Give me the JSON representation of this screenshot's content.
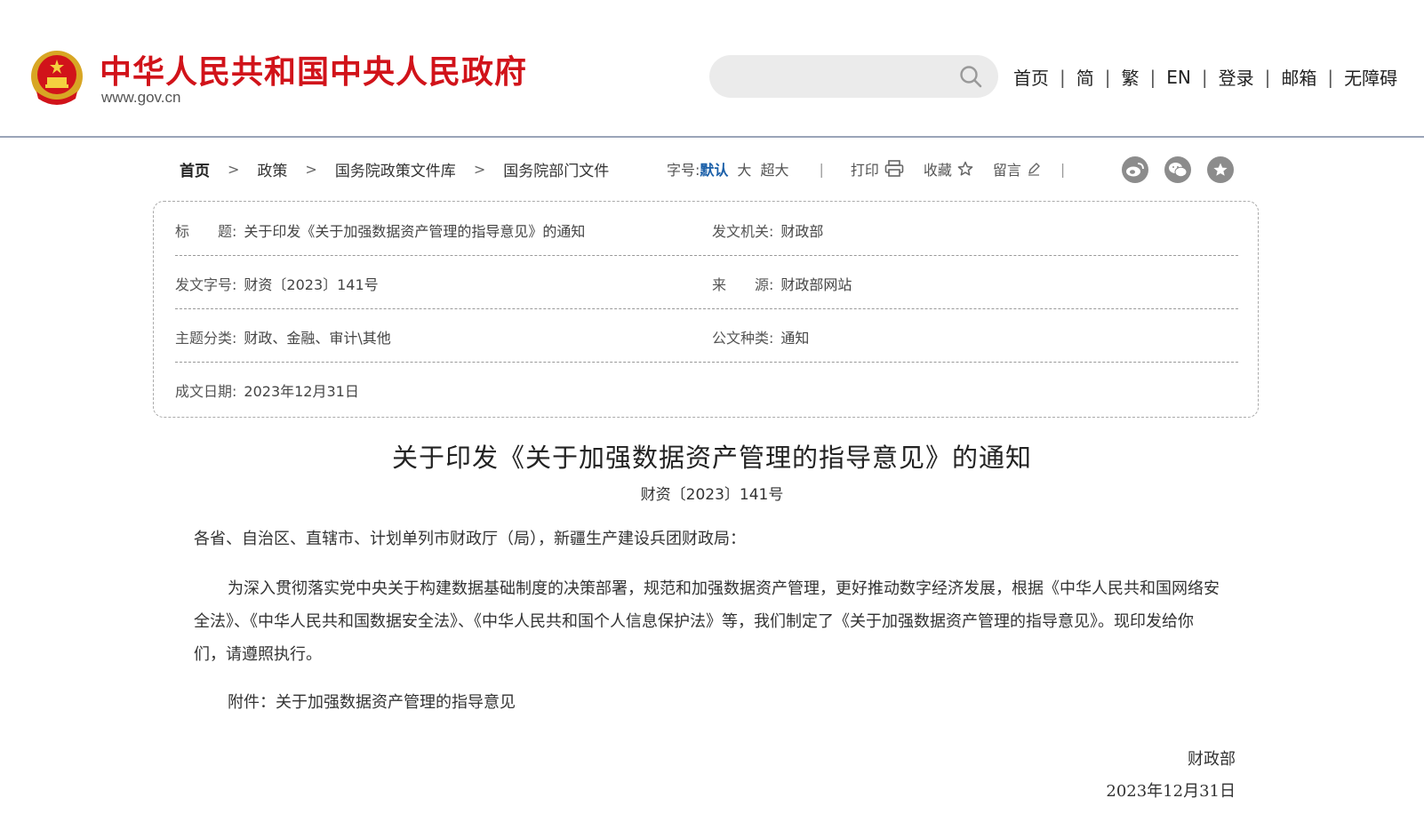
{
  "header": {
    "site_title": "中华人民共和国中央人民政府",
    "site_url": "www.gov.cn",
    "search_placeholder": "",
    "nav": [
      "首页",
      "简",
      "繁",
      "EN",
      "登录",
      "邮箱",
      "无障碍"
    ],
    "nav_separator": "|"
  },
  "breadcrumb": {
    "items": [
      "首页",
      "政策",
      "国务院政策文件库",
      "国务院部门文件"
    ],
    "separator": ">"
  },
  "tools": {
    "font_label": "字号:",
    "font_default": "默认",
    "font_large": "大",
    "font_xlarge": "超大",
    "print": "打印",
    "favorite": "收藏",
    "comment": "留言",
    "divider": "|"
  },
  "info": {
    "title_label": "标　　题:",
    "title_value": "关于印发《关于加强数据资产管理的指导意见》的通知",
    "issuer_label": "发文机关:",
    "issuer_value": "财政部",
    "docno_label": "发文字号:",
    "docno_value": "财资〔2023〕141号",
    "source_label": "来　　源:",
    "source_value": "财政部网站",
    "topic_label": "主题分类:",
    "topic_value": "财政、金融、审计\\其他",
    "type_label": "公文种类:",
    "type_value": "通知",
    "date_label": "成文日期:",
    "date_value": "2023年12月31日"
  },
  "article": {
    "title": "关于印发《关于加强数据资产管理的指导意见》的通知",
    "doc_no": "财资〔2023〕141号",
    "greeting": "各省、自治区、直辖市、计划单列市财政厅（局），新疆生产建设兵团财政局：",
    "body": "为深入贯彻落实党中央关于构建数据基础制度的决策部署，规范和加强数据资产管理，更好推动数字经济发展，根据《中华人民共和国网络安全法》、《中华人民共和国数据安全法》、《中华人民共和国个人信息保护法》等，我们制定了《关于加强数据资产管理的指导意见》。现印发给你们，请遵照执行。",
    "attachment": "附件：关于加强数据资产管理的指导意见",
    "sign_org": "财政部",
    "sign_date": "2023年12月31日"
  },
  "colors": {
    "brand_red": "#d1131a",
    "accent_blue": "#1a5fa8",
    "share_gray": "#8c8c8c"
  }
}
